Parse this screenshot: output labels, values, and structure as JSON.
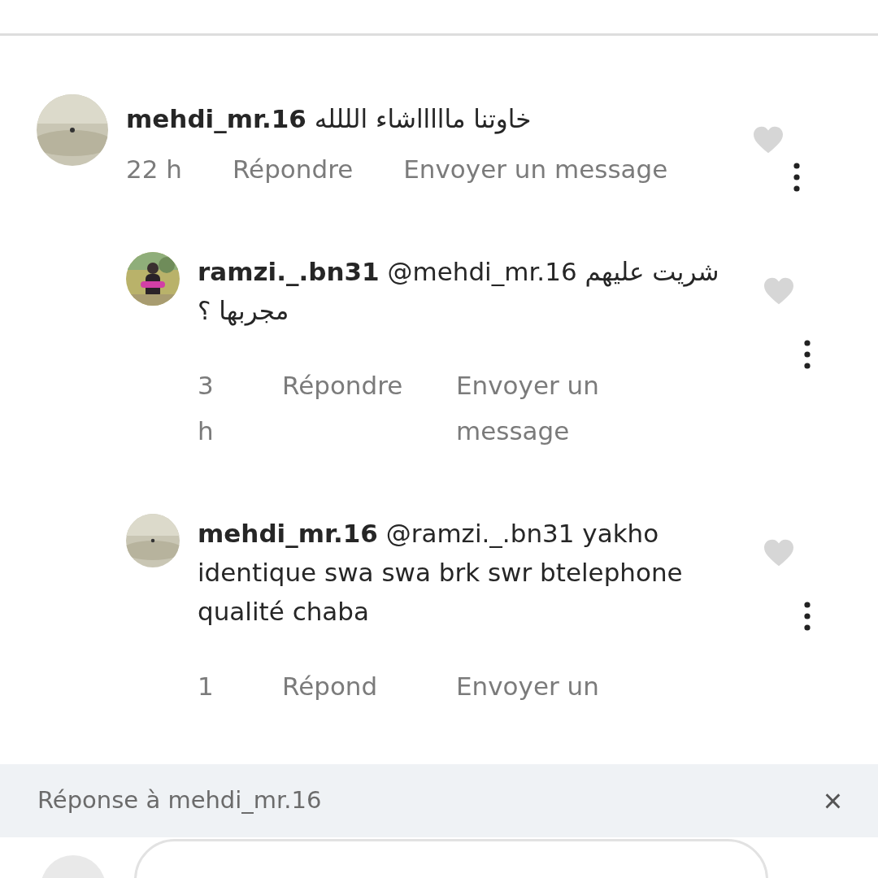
{
  "comments": [
    {
      "text": "**mehdi_mr.16** خاوتنا ماااااشاء الللله",
      "time": "22 h",
      "reply": "Répondre",
      "message": "Envoyer un message",
      "liked": false,
      "children": [
        {
          "text": "**ramzi._.bn31** @mehdi_mr.16 شريت عليهم مجربها ؟",
          "time": "3 h",
          "reply": "Répondre",
          "message": "Envoyer un message",
          "liked": false
        },
        {
          "text": "**mehdi_mr.16** @ramzi._.bn31 yakho identique swa swa brk swr btelephone qualité chaba",
          "time": "1",
          "reply": "Répond",
          "message": "Envoyer un",
          "liked": false
        }
      ]
    }
  ],
  "reply_bar": {
    "label": "Réponse à mehdi_mr.16",
    "close": "×"
  }
}
